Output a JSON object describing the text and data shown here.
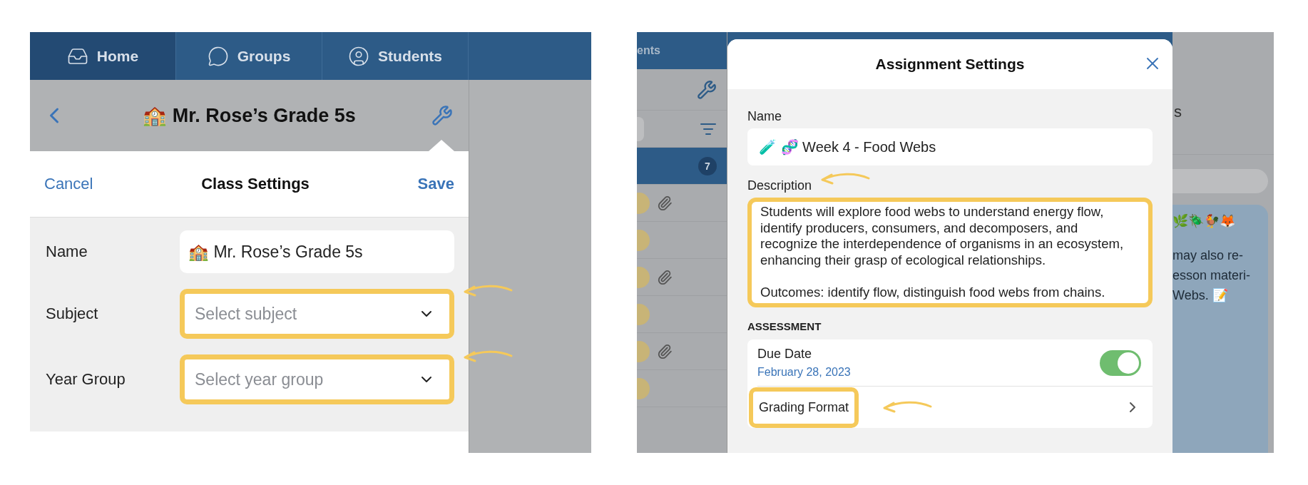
{
  "left_screen": {
    "tabs": [
      {
        "label": "Home",
        "selected": true
      },
      {
        "label": "Groups",
        "selected": false
      },
      {
        "label": "Students",
        "selected": false
      }
    ],
    "nav": {
      "title": "🏫 Mr. Rose’s Grade 5s"
    },
    "popover": {
      "cancel": "Cancel",
      "title": "Class Settings",
      "save": "Save",
      "fields": [
        {
          "kind": "text",
          "label": "Name",
          "value": "🏫 Mr. Rose’s Grade 5s",
          "highlighted": false
        },
        {
          "kind": "select",
          "label": "Subject",
          "placeholder": "Select subject",
          "highlighted": true
        },
        {
          "kind": "select",
          "label": "Year Group",
          "placeholder": "Select year group",
          "highlighted": true
        }
      ]
    }
  },
  "right_screen": {
    "background": {
      "tab_label": "ents",
      "badge": "7",
      "heading_fragment": "s",
      "emoji_line": "🌿🪲🐓🦊",
      "message_lines": [
        "may also re-",
        "esson materi-",
        "Webs. 📝"
      ],
      "rows": [
        {
          "attachment": true
        },
        {
          "attachment": false
        },
        {
          "attachment": true
        },
        {
          "attachment": false
        },
        {
          "attachment": true
        },
        {
          "attachment": false
        }
      ]
    },
    "modal": {
      "title": "Assignment Settings",
      "name_label": "Name",
      "name_value": "🧪 🧬 Week 4 - Food Webs",
      "description_label": "Description",
      "description_arrow": true,
      "description": "Students will explore food webs to understand energy flow, identify producers, consumers, and decomposers, and recognize the interdependence of organisms in an ecosystem, enhancing their grasp of ecological relationships.\n\nOutcomes: identify flow, distinguish food webs from chains.",
      "description_highlighted": true,
      "section": "ASSESSMENT",
      "due_date": {
        "label": "Due Date",
        "date": "February 28, 2023",
        "on": true
      },
      "grading": {
        "label": "Grading Format",
        "highlighted": true
      }
    }
  }
}
